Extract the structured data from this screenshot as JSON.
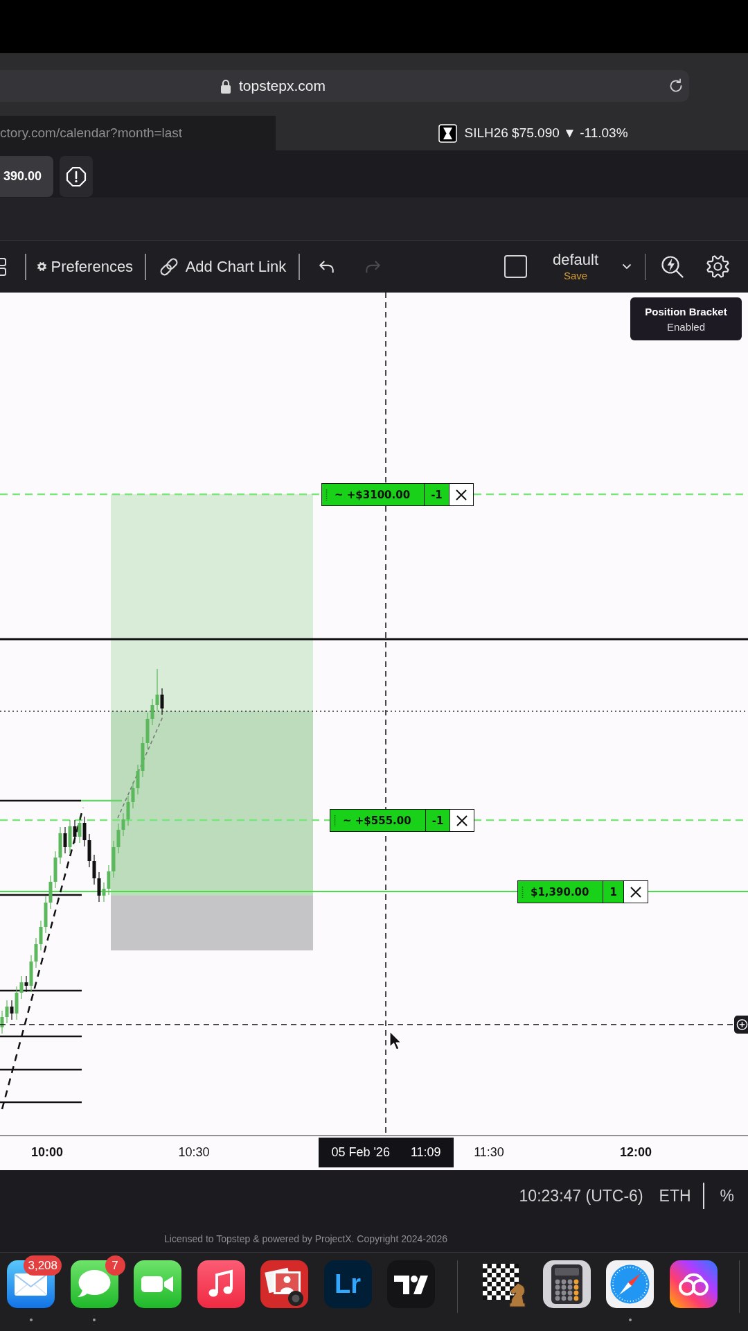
{
  "browser": {
    "address": "topstepx.com",
    "tabs": [
      {
        "title": "ctory.com/calendar?month=last",
        "icon": false,
        "selected": false
      },
      {
        "title": "SILH26 $75.090 ▼ -11.03%",
        "icon": true,
        "selected": true
      }
    ]
  },
  "account_bar": {
    "balance": "390.00"
  },
  "toolbar": {
    "preferences": "Preferences",
    "add_chart_link": "Add Chart Link",
    "undo": {
      "disabled": false
    },
    "redo": {
      "disabled": true
    },
    "checkbox": {
      "checked": false
    },
    "layout": {
      "name": "default",
      "action": "Save"
    }
  },
  "chart": {
    "position_bracket": {
      "title": "Position Bracket",
      "status": "Enabled"
    },
    "orders": [
      {
        "kind": "target",
        "label": "~ +$3100.00",
        "quantity": "-1"
      },
      {
        "kind": "target",
        "label": "~ +$555.00",
        "quantity": "-1"
      },
      {
        "kind": "position",
        "label": "$1,390.00",
        "quantity": "1"
      }
    ],
    "crosshair": {
      "date": "05 Feb '26",
      "time": "11:09"
    },
    "time_axis": [
      {
        "label": "10:00",
        "major": true
      },
      {
        "label": "10:30",
        "major": false
      },
      {
        "label": "11:30",
        "major": false
      },
      {
        "label": "12:00",
        "major": true
      }
    ]
  },
  "status_bar": {
    "clock": "10:23:47 (UTC-6)",
    "session": "ETH",
    "percent": "%"
  },
  "footer": {
    "copyright": "Licensed to Topstep & powered by ProjectX. Copyright 2024-2026"
  },
  "dock": {
    "apps": [
      {
        "kind": "mail",
        "badge": "3,208",
        "running": true
      },
      {
        "kind": "messages",
        "badge": "7",
        "running": true
      },
      {
        "kind": "video",
        "running": false
      },
      {
        "kind": "music",
        "running": false
      },
      {
        "kind": "photos",
        "running": false
      },
      {
        "kind": "letters",
        "label": "Lr",
        "running": false
      },
      {
        "kind": "logo",
        "running": false
      }
    ],
    "recent_apps": [
      {
        "kind": "chess",
        "running": false
      },
      {
        "kind": "calculator",
        "running": false
      },
      {
        "kind": "compass",
        "running": true
      },
      {
        "kind": "rainbow",
        "running": false
      }
    ]
  }
}
